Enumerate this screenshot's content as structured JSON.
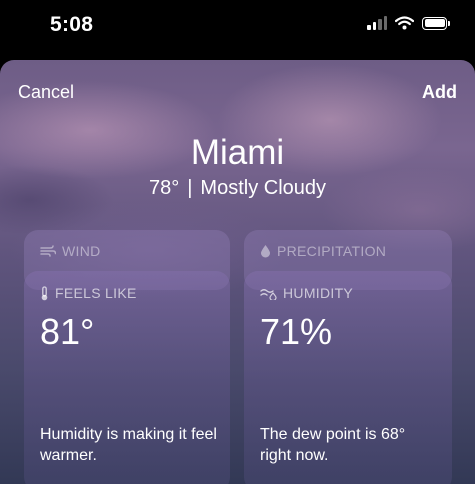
{
  "status_bar": {
    "time": "5:08",
    "icons": [
      "signal-icon",
      "wifi-icon",
      "battery-icon"
    ]
  },
  "header": {
    "cancel_label": "Cancel",
    "add_label": "Add"
  },
  "location": {
    "city": "Miami",
    "temperature": "78°",
    "separator": "|",
    "condition": "Mostly Cloudy"
  },
  "cards_back": [
    {
      "label": "WIND",
      "icon": "wind-icon"
    },
    {
      "label": "PRECIPITATION",
      "icon": "raindrop-icon"
    }
  ],
  "cards": [
    {
      "label": "FEELS LIKE",
      "icon": "thermometer-icon",
      "value": "81°",
      "description": "Humidity is making it feel warmer."
    },
    {
      "label": "HUMIDITY",
      "icon": "humidity-icon",
      "value": "71%",
      "description": "The dew point is 68° right now."
    }
  ]
}
